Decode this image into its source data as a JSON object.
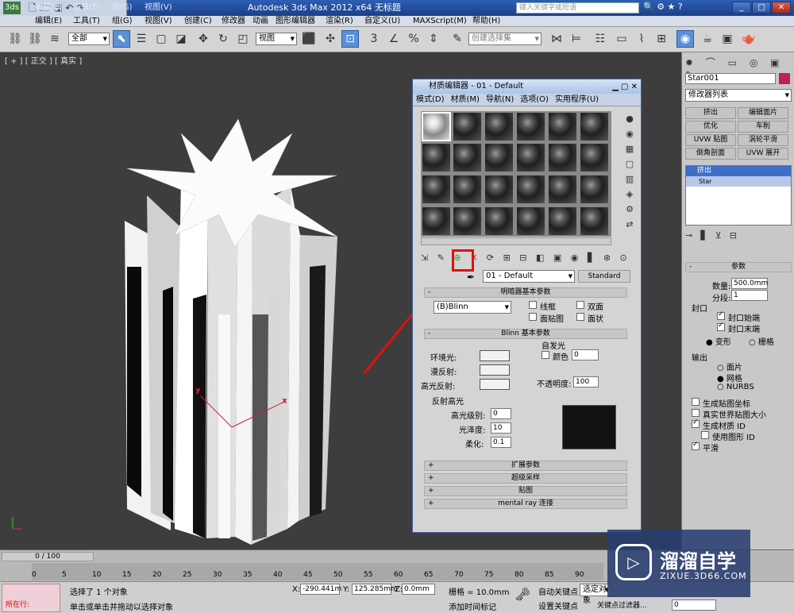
{
  "titlebar": {
    "title": "Autodesk 3ds Max  2012 x64      无标题",
    "search_placeholder": "键入关键字或短语",
    "menus": [
      "编辑(E)",
      "工具(T)",
      "组(G)",
      "视图(V)",
      "创建(C)",
      "修改器",
      "动画",
      "图形编辑器",
      "渲染(R)",
      "自定义(U)",
      "MAXScript(M)",
      "帮助(H)"
    ]
  },
  "toolbar": {
    "selection_filter": "全部",
    "ref_coord": "视图",
    "named_selection": "创建选择集"
  },
  "viewport": {
    "label": "[ + ] [ 正交 ] [ 真实 ]"
  },
  "material_editor": {
    "title": "材质编辑器 - 01 - Default",
    "menus": [
      "模式(D)",
      "材质(M)",
      "导航(N)",
      "选项(O)",
      "实用程序(U)"
    ],
    "material_name": "01 - Default",
    "material_type": "Standard",
    "shader_rollout": "明暗器基本参数",
    "shader": "(B)Blinn",
    "wire": "线框",
    "two_sided": "双面",
    "facemap": "面贴图",
    "faceted": "面状",
    "blinn_rollout": "Blinn 基本参数",
    "self_illum": "自发光",
    "color_label": "颜色",
    "color_value": "0",
    "ambient": "环境光:",
    "diffuse": "漫反射:",
    "specular": "高光反射:",
    "opacity_label": "不透明度:",
    "opacity": "100",
    "spec_highlight": "反射高光",
    "spec_level_label": "高光级别:",
    "spec_level": "0",
    "gloss_label": "光泽度:",
    "gloss": "10",
    "soften_label": "柔化:",
    "soften": "0.1",
    "rollouts": [
      "扩展参数",
      "超级采样",
      "贴图",
      "mental ray 连接"
    ]
  },
  "command_panel": {
    "object_name": "Star001",
    "object_color": "#c0205a",
    "modifier_list": "修改器列表",
    "buttons": [
      "挤出",
      "编辑面片",
      "优化",
      "车削",
      "UVW 贴图",
      "涡轮平滑",
      "倒角剖面",
      "UVW 展开"
    ],
    "stack": [
      "挤出",
      "Star"
    ],
    "params_title": "参数",
    "amount_label": "数量:",
    "amount": "500.0mm",
    "segments_label": "分段:",
    "segments": "1",
    "capping": "封口",
    "cap_start": "封口始端",
    "cap_end": "封口末端",
    "morph": "变形",
    "grid": "栅格",
    "output": "输出",
    "patch": "面片",
    "mesh": "网格",
    "nurbs": "NURBS",
    "gen_map": "生成贴图坐标",
    "real_world": "真实世界贴图大小",
    "gen_mat_id": "生成材质 ID",
    "use_shape_id": "使用图形 ID",
    "smooth": "平滑"
  },
  "timeline": {
    "frame": "0 / 100",
    "ticks": [
      "0",
      "5",
      "10",
      "15",
      "20",
      "25",
      "30",
      "35",
      "40",
      "45",
      "50",
      "55",
      "60",
      "65",
      "70",
      "75",
      "80",
      "85",
      "90"
    ]
  },
  "status": {
    "running": "所在行:",
    "selected": "选择了 1 个对象",
    "prompt": "单击或单击并拖动以选择对象",
    "x_label": "X:",
    "x": "-290.441m",
    "y_label": "Y:",
    "y": "125.285mm",
    "z_label": "Z:",
    "z": "0.0mm",
    "grid": "栅格 = 10.0mm",
    "add_time_tag": "添加时间标记",
    "auto_key": "自动关键点",
    "set_key": "设置关键点",
    "selected_obj": "选定对象",
    "key_filters": "关键点过滤器...",
    "frame_field": "0"
  },
  "watermark": {
    "brand": "溜溜自学",
    "url": "ZIXUE.3D66.COM"
  }
}
